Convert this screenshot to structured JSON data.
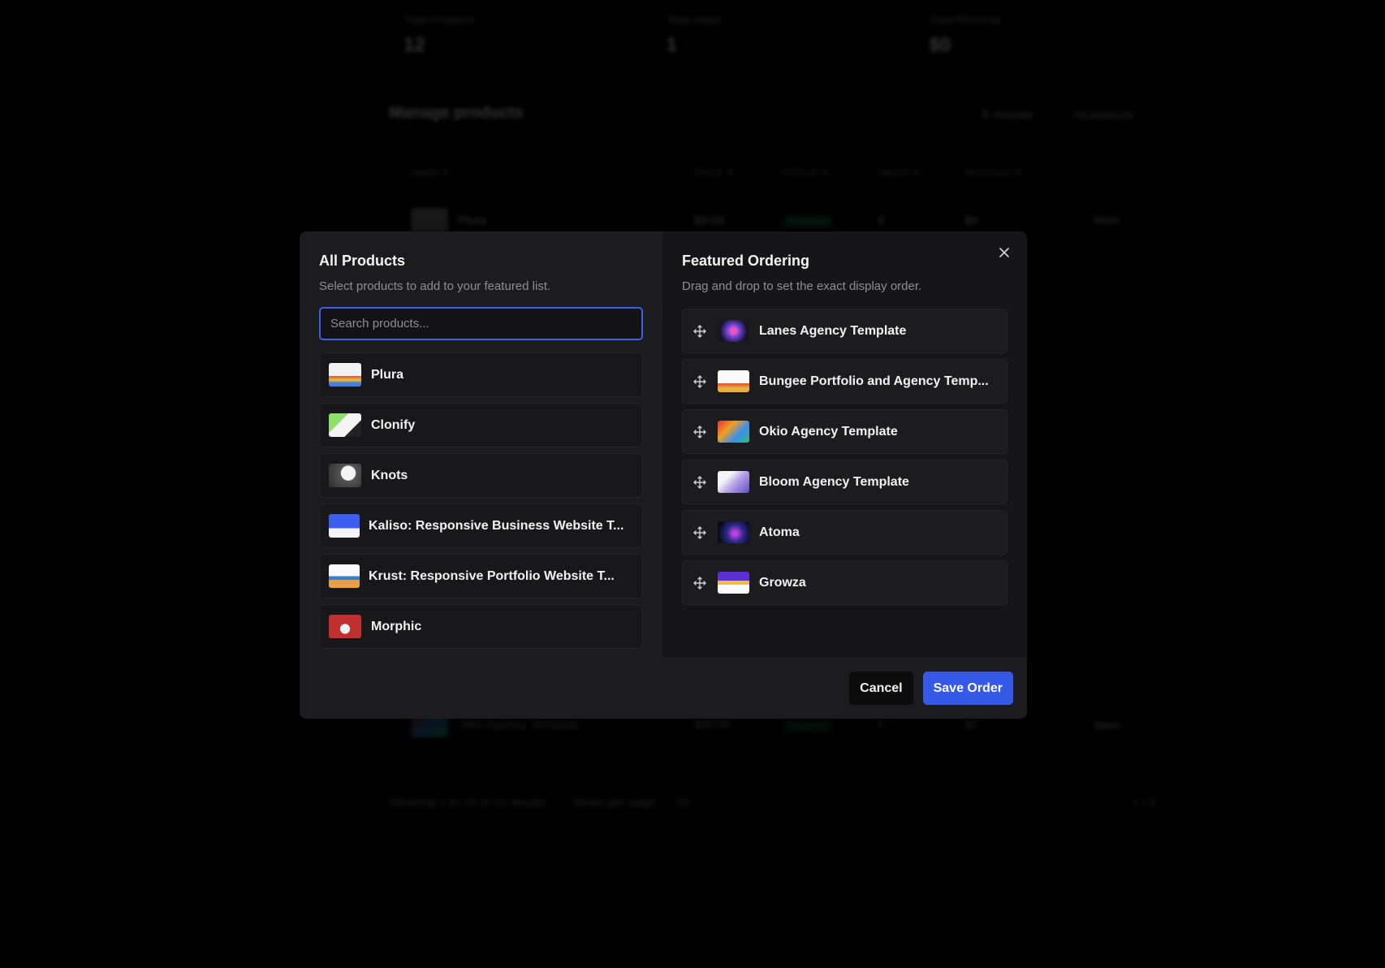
{
  "background": {
    "stats": [
      {
        "label": "Total Products",
        "value": "12"
      },
      {
        "label": "Total Sales",
        "value": "1"
      },
      {
        "label": "Total Revenue",
        "value": "$0"
      }
    ],
    "title": "Manage products",
    "reorder_label": "⇅ Reorder",
    "filter_label": "All products ⌄",
    "columns": [
      "Name ⇅",
      "Price ⇅",
      "Status ⇅",
      "Sales ⇅",
      "Revenue ⇅"
    ],
    "rows": [
      {
        "name": "Plura",
        "price": "$0.00",
        "status": "Published",
        "sales": "0",
        "revenue": "$0"
      },
      {
        "name": "Okio Agency Template",
        "price": "$99.00",
        "status": "Published",
        "sales": "0",
        "revenue": "$0"
      }
    ],
    "share_label": "Share",
    "footer": {
      "showing": "Showing 1 to 10 of 12 results",
      "rows_per_page": "Rows per page",
      "rows_value": "10",
      "page": "1 / 2"
    }
  },
  "modal": {
    "left": {
      "title": "All Products",
      "subtitle": "Select products to add to your featured list.",
      "search_placeholder": "Search products...",
      "items": [
        {
          "name": "Plura"
        },
        {
          "name": "Clonify"
        },
        {
          "name": "Knots"
        },
        {
          "name": "Kaliso: Responsive Business Website T..."
        },
        {
          "name": "Krust: Responsive Portfolio Website T..."
        },
        {
          "name": "Morphic"
        }
      ]
    },
    "right": {
      "title": "Featured Ordering",
      "subtitle": "Drag and drop to set the exact display order.",
      "items": [
        {
          "name": "Lanes Agency Template"
        },
        {
          "name": "Bungee Portfolio and Agency Temp..."
        },
        {
          "name": "Okio Agency Template"
        },
        {
          "name": "Bloom Agency Template"
        },
        {
          "name": "Atoma"
        },
        {
          "name": "Growza"
        }
      ]
    },
    "cancel_label": "Cancel",
    "save_label": "Save Order",
    "accent": "#3558e6"
  }
}
